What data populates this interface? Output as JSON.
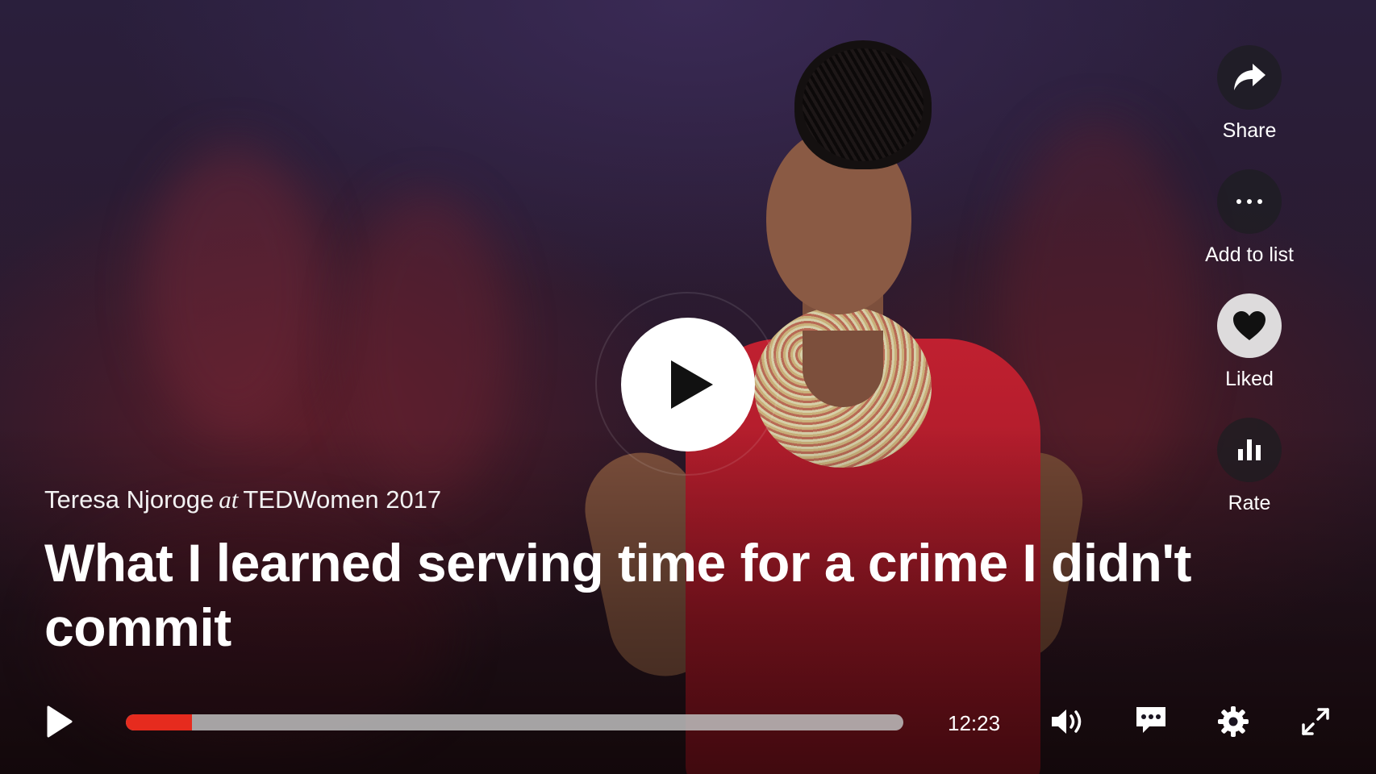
{
  "player": {
    "speaker": "Teresa Njoroge",
    "at_word": "at",
    "event": "TEDWomen 2017",
    "title": "What I learned serving time for a crime I didn't commit",
    "big_play_icon": "play-icon"
  },
  "actions": [
    {
      "label": "Share",
      "icon": "share-arrow-icon"
    },
    {
      "label": "Add to list",
      "icon": "more-dots-icon"
    },
    {
      "label": "Liked",
      "icon": "heart-icon",
      "active": true
    },
    {
      "label": "Rate",
      "icon": "bar-chart-icon"
    }
  ],
  "controls": {
    "duration": "12:23",
    "progress_fraction": 0.085,
    "icons": [
      "play-icon",
      "volume-icon",
      "captions-icon",
      "settings-gear-icon",
      "fullscreen-icon"
    ]
  },
  "colors": {
    "accent": "#e62b1e",
    "progress_track": "#bebebe",
    "text": "#ffffff"
  }
}
